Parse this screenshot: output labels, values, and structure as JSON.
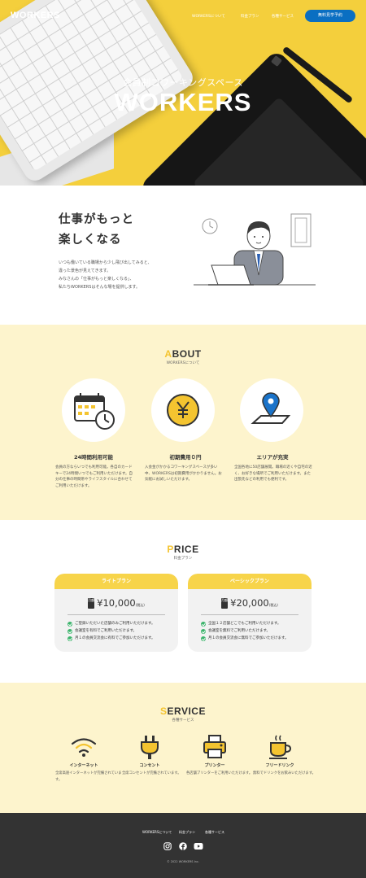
{
  "header": {
    "logo": "WORKERS",
    "nav": [
      "WORKERSについて",
      "料金プラン",
      "各種サービス"
    ],
    "cta": "無料見学予約"
  },
  "hero": {
    "subtitle": "会員制コワーキングスペース",
    "title": "WORKERS"
  },
  "intro": {
    "title_line1": "仕事がもっと",
    "title_line2": "楽しくなる",
    "body": [
      "いつも働いている職場から少し飛び出してみると、",
      "違った景色が見えてきます。",
      "みなさんの「仕事がもっと楽しくなる」、",
      "私たちWORKERSはそんな場を提供します。"
    ]
  },
  "about": {
    "heading_first": "A",
    "heading_rest": "BOUT",
    "sub": "WORKERSについて",
    "features": [
      {
        "icon": "calendar-clock-icon",
        "title": "24時間利用可能",
        "body": [
          "会員の方ならいつでも利用可能。各自のカードキーで24時間いつでもご利用いただけます。",
          "自分の仕事の時間帯やライフスタイルに合わせてご利用いただけます。"
        ]
      },
      {
        "icon": "yen-coin-icon",
        "title": "初期費用０円",
        "body": [
          "入会金がかかるコワーキングスペースが多い中、WORKERSは初期費用がかかりません。",
          "お気軽にお試しいただけます。"
        ]
      },
      {
        "icon": "map-pin-icon",
        "title": "エリアが充実",
        "body": [
          "全国各地に50店舗展開。職場の近くや自宅の近く、お好きな場所でご利用いただけます。",
          "また出張先などの利用でも便利です。"
        ]
      }
    ]
  },
  "price": {
    "heading_first": "P",
    "heading_rest": "RICE",
    "sub": "料金プラン",
    "plans": [
      {
        "name": "ライトプラン",
        "tag": "月額",
        "amount": "¥10,000",
        "tax": "(税込)",
        "features": [
          "ご登録いただいた店舗のみご利用いただけます。",
          "会議室を有料でご利用いただけます。",
          "月１の会員交流会に有料でご参加いただけます。"
        ]
      },
      {
        "name": "ベーシックプラン",
        "tag": "月額",
        "amount": "¥20,000",
        "tax": "(税込)",
        "features": [
          "全国１２店舗どこでもご利用いただけます。",
          "会議室を無料でご利用いただけます。",
          "月１の会員交流会に無料でご参加いただけます。"
        ]
      }
    ]
  },
  "service": {
    "heading_first": "S",
    "heading_rest": "ERVICE",
    "sub": "各種サービス",
    "items": [
      {
        "icon": "wifi-icon",
        "title": "インターネット",
        "body": [
          "全席高速インターネットが完備されています。"
        ]
      },
      {
        "icon": "plug-icon",
        "title": "コンセント",
        "body": [
          "全席コンセントが完備されています。"
        ]
      },
      {
        "icon": "printer-icon",
        "title": "プリンター",
        "body": [
          "各店舗プリンターをご利用いただけます。"
        ]
      },
      {
        "icon": "coffee-icon",
        "title": "フリードリンク",
        "body": [
          "無料でドリンクをお飲みいただけます。"
        ]
      }
    ]
  },
  "footer": {
    "nav": [
      "WORKERSについて",
      "料金プラン",
      "各種サービス"
    ],
    "copyright": "© 2022 WORKERS Inc."
  },
  "colors": {
    "accent": "#f4cf3c",
    "cta": "#0a6fc2",
    "footer": "#333333",
    "cream": "#fdf4cd",
    "check": "#3bb36b"
  }
}
